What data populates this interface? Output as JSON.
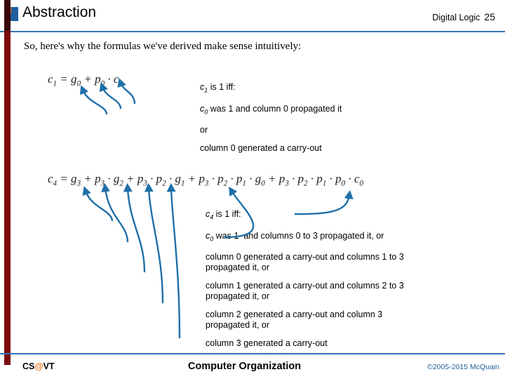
{
  "header": {
    "title": "Abstraction",
    "course": "Digital Logic",
    "page_number": "25",
    "icon": "square-logo-icon",
    "rule_color": "#2e74b5"
  },
  "body": {
    "intro": "So, here's why the formulas we've derived make sense intuitively:",
    "formula1": "c₁ = g₀ + p₀ · c₀",
    "formula1_html": "c<sub>1</sub> = g<sub>0</sub> + p<sub>0</sub> · c<sub>0</sub>",
    "formula2_html": "c<sub>4</sub> = g<sub>3</sub> + p<sub>3</sub> · g<sub>2</sub> + p<sub>3</sub> · p<sub>2</sub> · g<sub>1</sub> + p<sub>3</sub> · p<sub>2</sub> · p<sub>1</sub> · g<sub>0</sub> + p<sub>3</sub> · p<sub>2</sub> · p<sub>1</sub> · p<sub>0</sub> · c<sub>0</sub>",
    "explanation1": [
      "c<sub>1</sub> is 1 iff:",
      "c<sub>0</sub> was 1 and column 0 propagated it",
      "or",
      "column 0 generated a carry-out"
    ],
    "explanation2": [
      "c<sub>4</sub> is 1 iff:",
      "c<sub>0</sub> was 1  and columns 0 to 3 propagated it, or",
      "column 0 generated a carry-out and columns 1 to 3 propagated it, or",
      "column 1 generated a carry-out and columns 2 to 3 propagated it, or",
      "column 2 generated a carry-out and column 3 propagated it, or",
      "column 3 generated a carry-out"
    ],
    "arrow_color": "#1f6fa8"
  },
  "footer": {
    "left": "CS@VT",
    "center": "Computer Organization",
    "right": "©2005-2015 McQuain",
    "rule_color": "#2e74b5"
  }
}
